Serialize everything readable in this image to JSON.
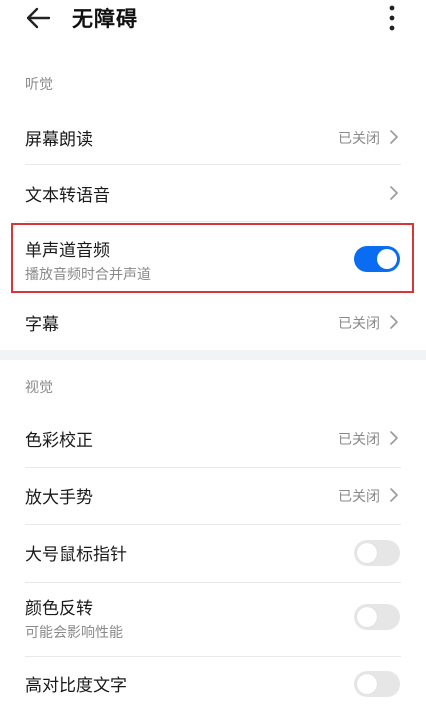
{
  "app_bar": {
    "title": "无障碍",
    "back_icon": "arrow-left-icon",
    "more_icon": "more-vertical-icon"
  },
  "sections": {
    "hearing": {
      "label": "听觉",
      "items": [
        {
          "title": "屏幕朗读",
          "value": "已关闭"
        },
        {
          "title": "文本转语音"
        },
        {
          "title": "单声道音频",
          "subtitle": "播放音频时合并声道",
          "toggle": "on"
        },
        {
          "title": "字幕",
          "value": "已关闭"
        }
      ]
    },
    "vision": {
      "label": "视觉",
      "items": [
        {
          "title": "色彩校正",
          "value": "已关闭"
        },
        {
          "title": "放大手势",
          "value": "已关闭"
        },
        {
          "title": "大号鼠标指针",
          "toggle": "off"
        },
        {
          "title": "颜色反转",
          "subtitle": "可能会影响性能",
          "toggle": "off"
        },
        {
          "title": "高对比度文字"
        }
      ]
    }
  },
  "colors": {
    "accent": "#0a6cf0",
    "highlight": "#d9363a",
    "secondary_text": "#8a8a8a"
  }
}
